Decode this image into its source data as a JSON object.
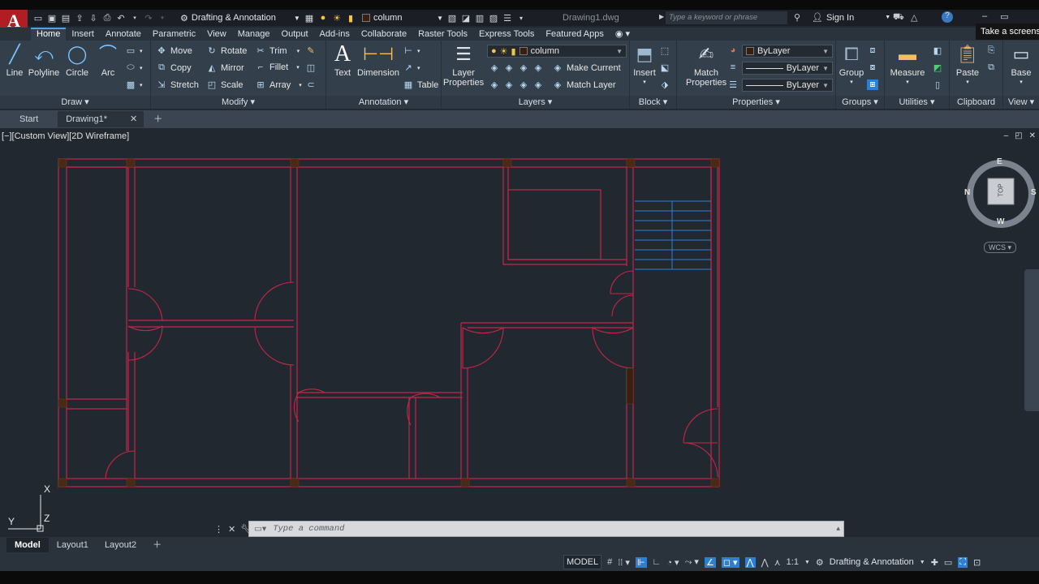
{
  "app": {
    "logo_letter": "A",
    "workspace": "Drafting & Annotation",
    "current_layer": "column",
    "doc_title": "Drawing1.dwg",
    "search_placeholder": "Type a keyword or phrase",
    "sign_in": "Sign In",
    "tooltip": "Take a screenshot"
  },
  "menu_tabs": [
    "Home",
    "Insert",
    "Annotate",
    "Parametric",
    "View",
    "Manage",
    "Output",
    "Add-ins",
    "Collaborate",
    "Raster Tools",
    "Express Tools",
    "Featured Apps"
  ],
  "ribbon": {
    "draw": {
      "title": "Draw",
      "line": "Line",
      "polyline": "Polyline",
      "circle": "Circle",
      "arc": "Arc"
    },
    "modify": {
      "title": "Modify",
      "move": "Move",
      "rotate": "Rotate",
      "trim": "Trim",
      "copy": "Copy",
      "mirror": "Mirror",
      "fillet": "Fillet",
      "stretch": "Stretch",
      "scale": "Scale",
      "array": "Array"
    },
    "annotation": {
      "title": "Annotation",
      "text": "Text",
      "dimension": "Dimension",
      "table": "Table"
    },
    "layers": {
      "title": "Layers",
      "layer_properties_1": "Layer",
      "layer_properties_2": "Properties",
      "layer_name": "column",
      "make_current": "Make Current",
      "match_layer": "Match Layer"
    },
    "block": {
      "title": "Block",
      "insert": "Insert"
    },
    "properties": {
      "title": "Properties",
      "match_1": "Match",
      "match_2": "Properties",
      "color": "ByLayer",
      "linetype": "ByLayer",
      "lineweight": "ByLayer"
    },
    "groups": {
      "title": "Groups",
      "group": "Group"
    },
    "utilities": {
      "title": "Utilities",
      "measure": "Measure"
    },
    "clipboard": {
      "title": "Clipboard",
      "paste": "Paste"
    },
    "view": {
      "title": "View",
      "base": "Base"
    }
  },
  "file_tabs": {
    "start": "Start",
    "drawing": "Drawing1*"
  },
  "viewport": {
    "label": "[−][Custom View][2D Wireframe]",
    "compass": {
      "n": "N",
      "s": "S",
      "e": "E",
      "w": "W",
      "top": "TOP"
    },
    "wcs": "WCS",
    "ucs_x": "X",
    "ucs_y": "Y",
    "ucs_z": "Z"
  },
  "command": {
    "placeholder": "Type a command"
  },
  "layout_tabs": [
    "Model",
    "Layout1",
    "Layout2"
  ],
  "status": {
    "model": "MODEL",
    "scale": "1:1",
    "workspace": "Drafting & Annotation"
  },
  "colors": {
    "wall": "#c8244a",
    "column": "#4a2a14",
    "stair": "#2d7fd4",
    "accent": "#2f7fd0"
  }
}
